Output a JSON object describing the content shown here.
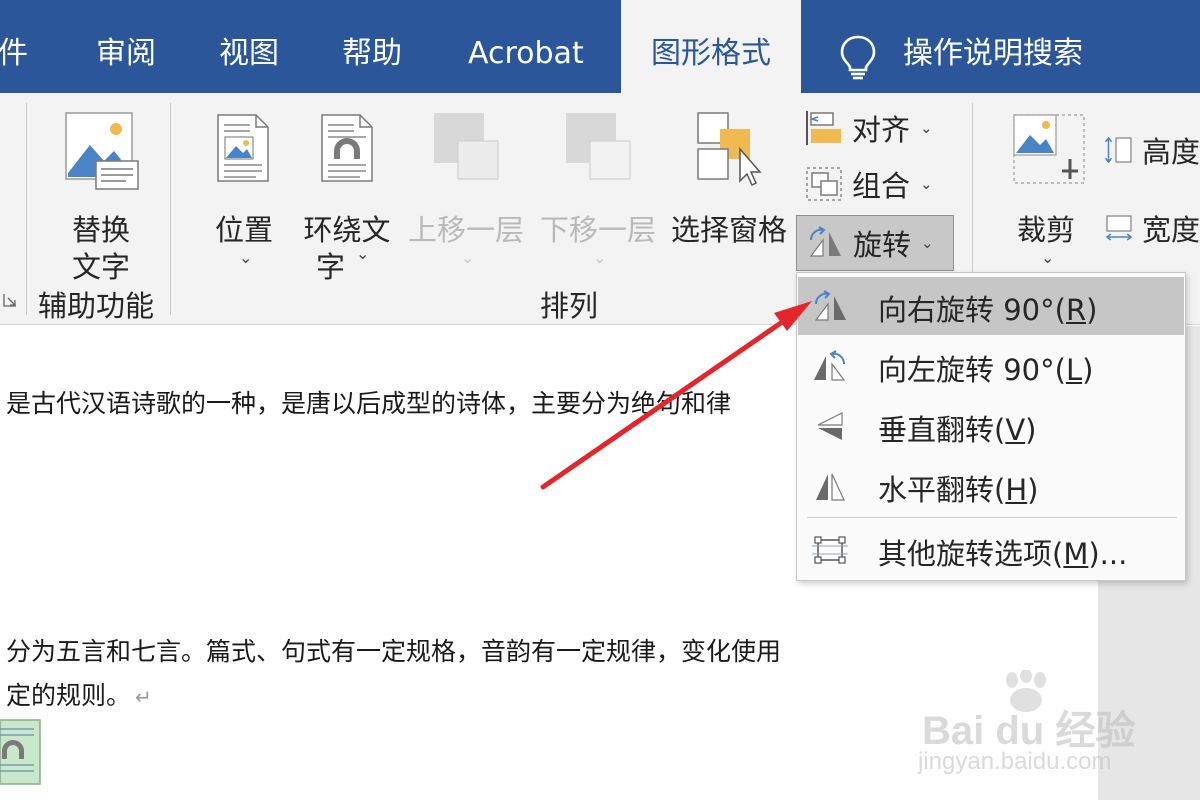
{
  "tabs": [
    {
      "label": "件"
    },
    {
      "label": "审阅"
    },
    {
      "label": "视图"
    },
    {
      "label": "帮助"
    },
    {
      "label": "Acrobat"
    },
    {
      "label": "图形格式",
      "active": true
    },
    {
      "label": "操作说明搜索"
    }
  ],
  "ribbon": {
    "alt_text": {
      "line1": "替换",
      "line2": "文字"
    },
    "accessibility_group": "辅助功能",
    "position": "位置",
    "wrap_text": {
      "line1": "环绕文",
      "line2": "字"
    },
    "bring_forward": "上移一层",
    "send_backward": "下移一层",
    "selection_pane": "选择窗格",
    "align": "对齐",
    "group": "组合",
    "rotate": "旋转",
    "arrange_group": "排列",
    "crop": "裁剪",
    "height": "高度",
    "width": "宽度"
  },
  "rotate_menu": {
    "items": [
      {
        "text": "向右旋转 90°(",
        "key": "R",
        "tail": ")",
        "icon": "rotate-right-icon",
        "highlighted": true
      },
      {
        "text": "向左旋转 90°(",
        "key": "L",
        "tail": ")",
        "icon": "rotate-left-icon"
      },
      {
        "text": "垂直翻转(",
        "key": "V",
        "tail": ")",
        "icon": "flip-vertical-icon"
      },
      {
        "text": "水平翻转(",
        "key": "H",
        "tail": ")",
        "icon": "flip-horizontal-icon"
      },
      {
        "text": "其他旋转选项(",
        "key": "M",
        "tail": ")...",
        "icon": "more-rotation-options-icon"
      }
    ]
  },
  "document": {
    "line1": "是古代汉语诗歌的一种，是唐以后成型的诗体，主要分为绝句和律",
    "line2": "分为五言和七言。篇式、句式有一定规格，音韵有一定规律，变化使用",
    "line3": "定的规则。",
    "para_mark": "↵"
  },
  "watermark": {
    "brand": "Bai  du 经验",
    "url": "jingyan.baidu.com"
  },
  "colors": {
    "accent": "#2b579a",
    "annotation_arrow": "#e3262b",
    "menu_highlight": "#c6c6c6"
  }
}
